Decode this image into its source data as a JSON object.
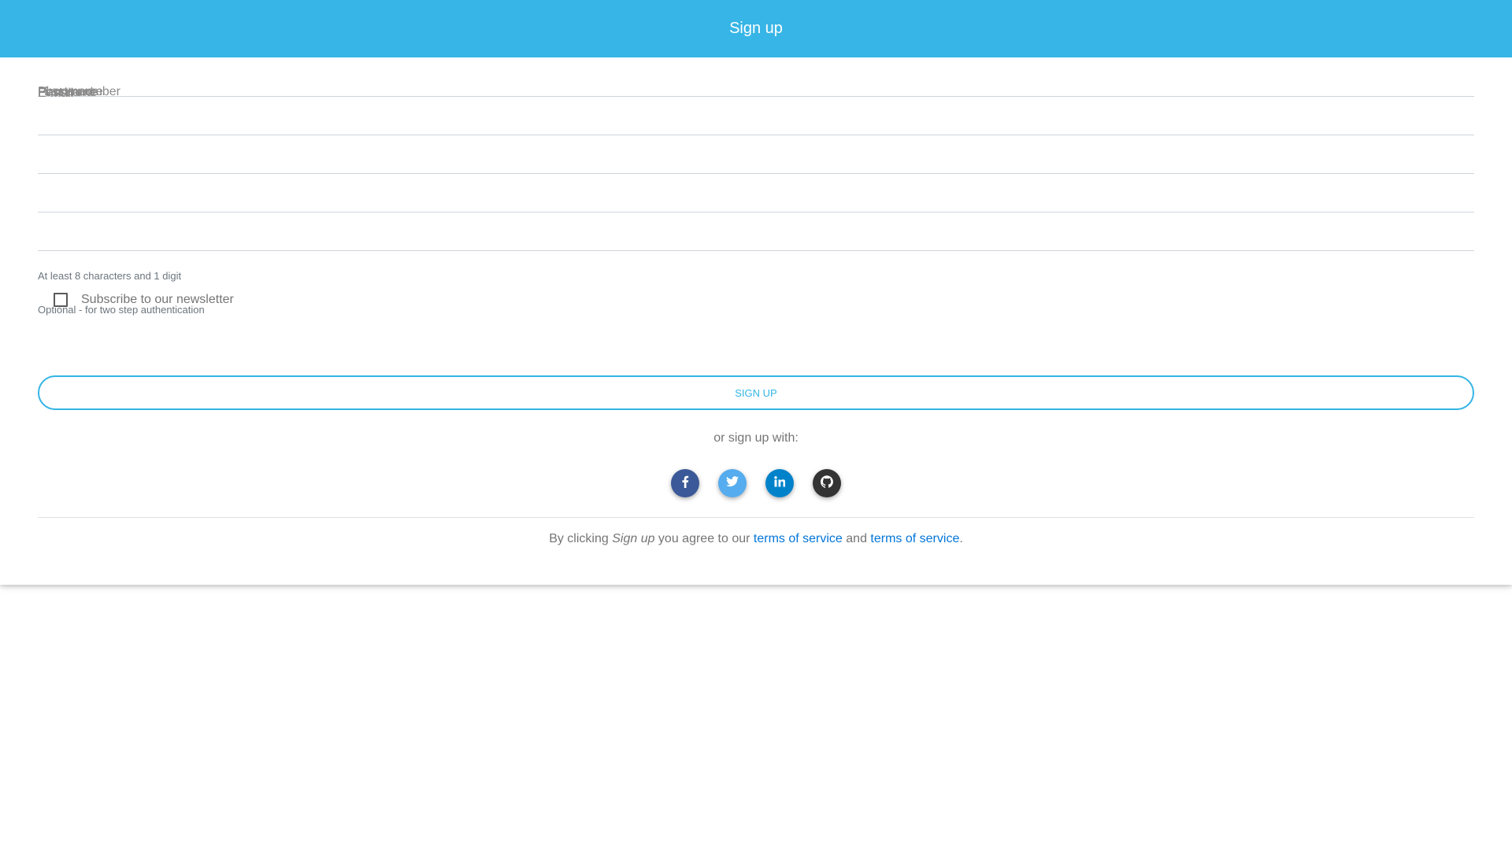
{
  "header": {
    "title": "Sign up"
  },
  "form": {
    "fields": [
      {
        "label": "First name",
        "value": ""
      },
      {
        "label": "Last name",
        "value": ""
      },
      {
        "label": "E-mail",
        "value": ""
      },
      {
        "label": "Password",
        "value": ""
      },
      {
        "label": "Phone number",
        "value": ""
      }
    ],
    "password_help": "At least 8 characters and 1 digit",
    "phone_help": "Optional - for two step authentication",
    "newsletter_label": "Subscribe to our newsletter",
    "newsletter_checked": false,
    "submit_label": "Sign up"
  },
  "social": {
    "prompt": "or sign up with:",
    "buttons": [
      {
        "icon": "facebook-icon",
        "color": "#3b5998"
      },
      {
        "icon": "twitter-icon",
        "color": "#55acee"
      },
      {
        "icon": "linkedin-icon",
        "color": "#0082ca"
      },
      {
        "icon": "github-icon",
        "color": "#333333"
      }
    ]
  },
  "terms": {
    "prefix": "By clicking ",
    "emphasis": "Sign up",
    "middle": " you agree to our ",
    "link1": "terms of service",
    "conjunction": " and ",
    "link2": "terms of service",
    "suffix": "."
  },
  "colors": {
    "header_bg": "#37b5e6",
    "accent": "#33b5e5",
    "link": "#0275d8"
  }
}
